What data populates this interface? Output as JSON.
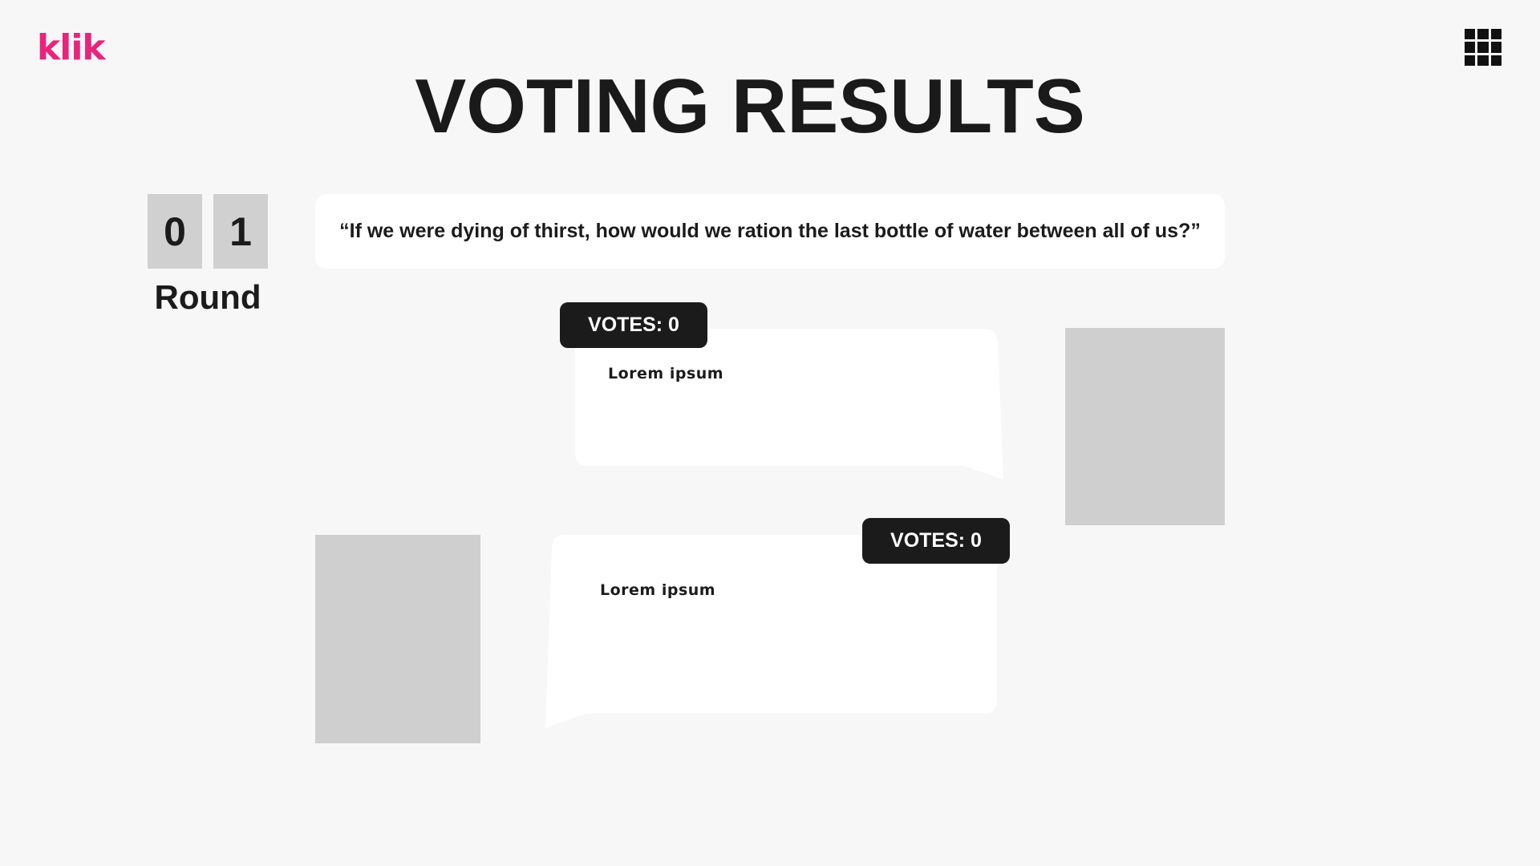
{
  "app": {
    "logo_text": "klik",
    "brand_color": "#e8247d",
    "menu_icon": "grid-icon"
  },
  "header": {
    "title": "VOTING RESULTS"
  },
  "round": {
    "digits": [
      "0",
      "1"
    ],
    "label": "Round"
  },
  "question": {
    "text": "“If we were dying of thirst, how would we ration the last bottle of water between all of us?”"
  },
  "answers": [
    {
      "text": "Lorem ipsum",
      "votes_label": "VOTES: 0"
    },
    {
      "text": "Lorem ipsum",
      "votes_label": "VOTES: 0"
    }
  ],
  "colors": {
    "background": "#f7f7f7",
    "card": "#ffffff",
    "badge": "#1b1b1b",
    "placeholder": "#cfcfcf"
  }
}
